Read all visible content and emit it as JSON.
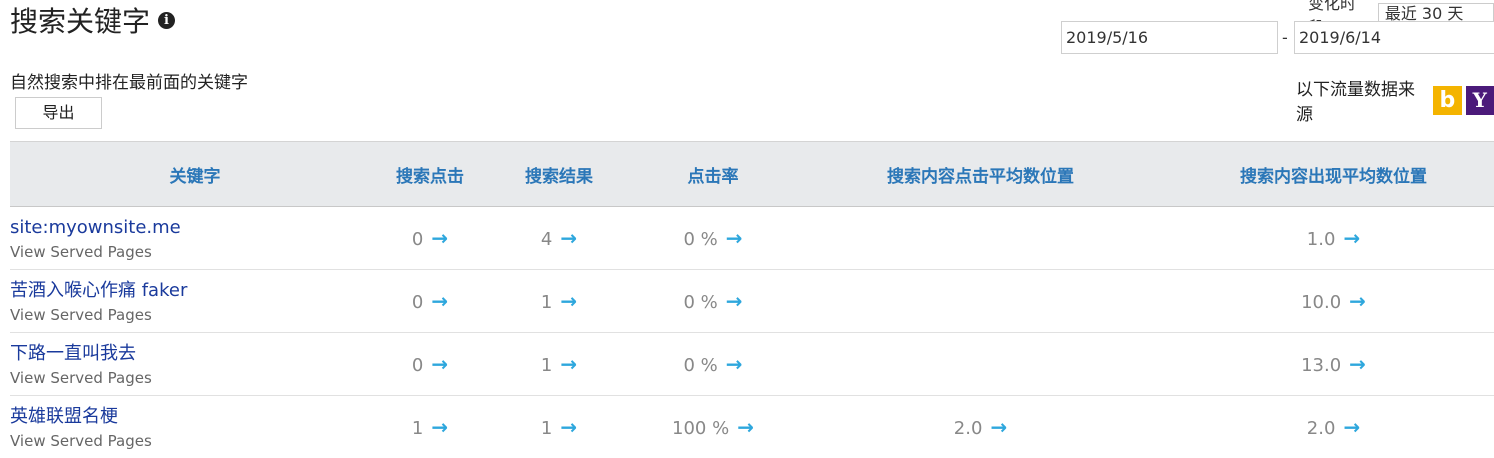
{
  "header": {
    "title": "搜索关键字",
    "info_icon": "i",
    "subtitle": "自然搜索中排在最前面的关键字",
    "export_label": "导出"
  },
  "period": {
    "label": "变化时段",
    "selected": "最近 30 天",
    "date_from": "2019/5/16",
    "separator": "-",
    "date_to": "2019/6/14"
  },
  "source": {
    "label": "以下流量数据来源",
    "bing_glyph": "b",
    "yahoo_glyph": "Y"
  },
  "table": {
    "columns": [
      "关键字",
      "搜索点击",
      "搜索结果",
      "点击率",
      "搜索内容点击平均数位置",
      "搜索内容出现平均数位置"
    ],
    "rows": [
      {
        "keyword": "site:myownsite.me",
        "sub": "View Served Pages",
        "clicks": "0",
        "results": "4",
        "ctr": "0 %",
        "avg_click_pos": "",
        "avg_impr_pos": "1.0"
      },
      {
        "keyword": "苦酒入喉心作痛 faker",
        "sub": "View Served Pages",
        "clicks": "0",
        "results": "1",
        "ctr": "0 %",
        "avg_click_pos": "",
        "avg_impr_pos": "10.0"
      },
      {
        "keyword": "下路一直叫我去",
        "sub": "View Served Pages",
        "clicks": "0",
        "results": "1",
        "ctr": "0 %",
        "avg_click_pos": "",
        "avg_impr_pos": "13.0"
      },
      {
        "keyword": "英雄联盟名梗",
        "sub": "View Served Pages",
        "clicks": "1",
        "results": "1",
        "ctr": "100 %",
        "avg_click_pos": "2.0",
        "avg_impr_pos": "2.0"
      }
    ]
  },
  "icons": {
    "arrow": "→"
  },
  "colors": {
    "header_text": "#2b77b8",
    "keyword_link": "#1a3a9c",
    "arrow": "#2ea7dd",
    "bing": "#f4b400",
    "yahoo": "#4b1a7a"
  }
}
